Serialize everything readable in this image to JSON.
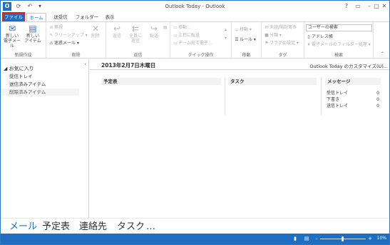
{
  "title": "Outlook Today - Outlook",
  "qat": {
    "app_icon": "outlook-icon",
    "undo": "undo-icon",
    "send_receive": "send-receive-icon"
  },
  "tabs": [
    {
      "label": "ファイル"
    },
    {
      "label": "ホーム"
    },
    {
      "label": "送受信"
    },
    {
      "label": "フォルダー"
    },
    {
      "label": "表示"
    }
  ],
  "ribbon": {
    "new": {
      "new_email": "新しい\n電子メール",
      "new_item": "新しい\nアイテム",
      "label": "新規作成"
    },
    "delete": {
      "ignore": "無視",
      "cleanup": "クリーンアップ",
      "junk": "迷惑メール",
      "delete": "削除",
      "label": "削除"
    },
    "respond": {
      "reply": "返信",
      "reply_all": "全員に\n返信",
      "forward": "転送",
      "label": "返信"
    },
    "quick_steps": {
      "item1": "移動...",
      "item2": "上司に転送",
      "item3": "チーム宛て電子...",
      "label": "クイック操作"
    },
    "move": {
      "move": "移動",
      "rules": "ルール",
      "label": "移動"
    },
    "tags": {
      "unread": "未読/開封済み",
      "categorize": "分類",
      "followup": "フラグの設定",
      "label": "タグ"
    },
    "find": {
      "search_people": "ユーザーの検索",
      "address_book": "アドレス帳",
      "filter_email": "電子メールのフィルター処理",
      "label": "検索"
    }
  },
  "nav": {
    "favorites": "お気に入り",
    "items": [
      "受信トレイ",
      "送信済みアイテム",
      "削除済みアイテム"
    ]
  },
  "main": {
    "date": "2013年2月7日木曜日",
    "customize": "Outlook Today のカスタマイズ(U)...",
    "calendar_header": "予定表",
    "tasks_header": "タスク",
    "messages_header": "メッセージ",
    "messages": [
      {
        "label": "受信トレイ",
        "count": "0"
      },
      {
        "label": "下書き",
        "count": "0"
      },
      {
        "label": "送信トレイ",
        "count": "0"
      }
    ]
  },
  "bottom_nav": [
    "メール",
    "予定表",
    "連絡先",
    "タスク",
    "…"
  ],
  "status": {
    "zoom": "10%"
  }
}
